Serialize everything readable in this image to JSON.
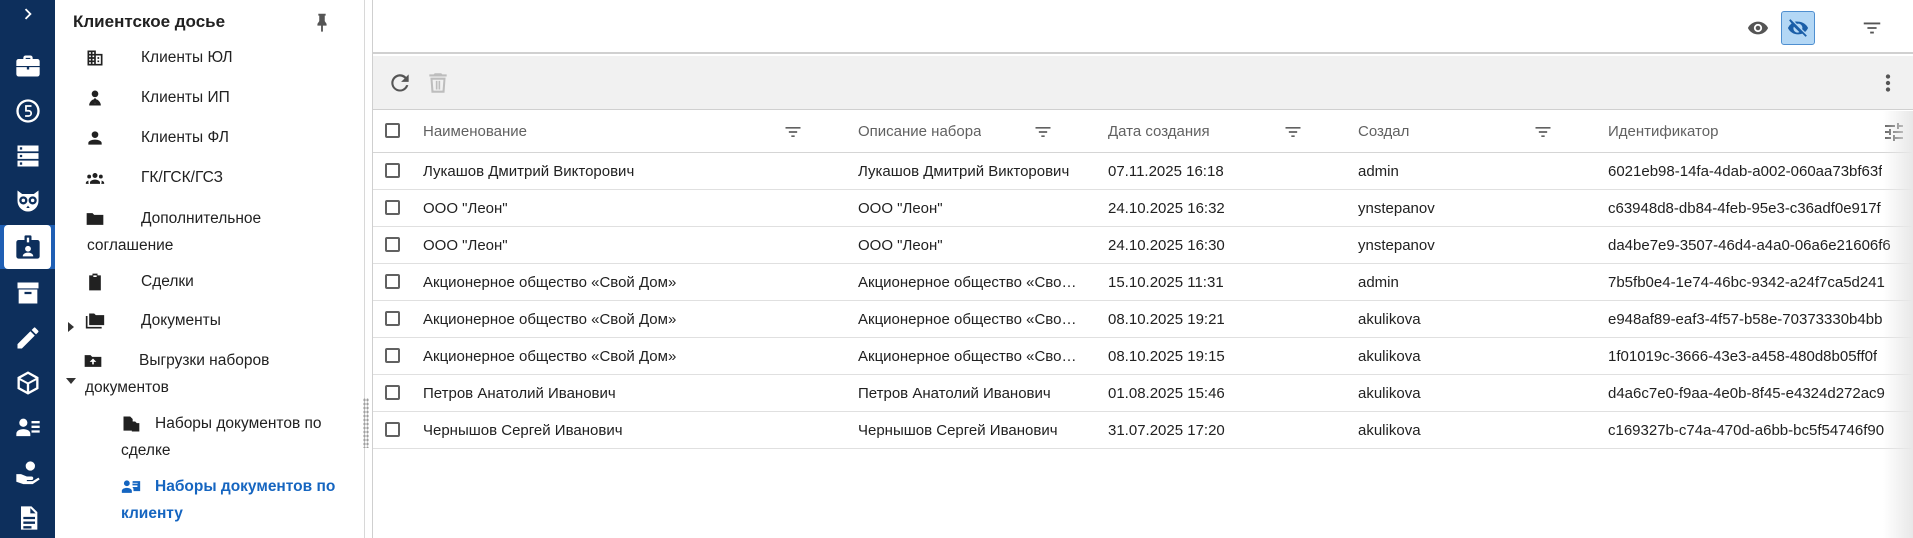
{
  "tree": {
    "title": "Клиентское досье",
    "items": [
      {
        "label": "Клиенты ЮЛ"
      },
      {
        "label": "Клиенты ИП"
      },
      {
        "label": "Клиенты ФЛ"
      },
      {
        "label": "ГК/ГСК/ГСЗ"
      },
      {
        "label_line1": "Дополнительное",
        "label_line2": "соглашение"
      },
      {
        "label": "Сделки"
      },
      {
        "label": "Документы"
      },
      {
        "label_line1": "Выгрузки наборов",
        "label_line2": "документов"
      },
      {
        "label_line1": "Наборы документов по",
        "label_line2": "сделке"
      },
      {
        "label_line1": "Наборы документов по",
        "label_line2": "клиенту"
      }
    ]
  },
  "grid": {
    "columns": [
      "Наименование",
      "Описание набора",
      "Дата создания",
      "Создал",
      "Идентификатор"
    ],
    "rows": [
      [
        "Лукашов Дмитрий Викторович",
        "Лукашов Дмитрий Викторович",
        "07.11.2025 16:18",
        "admin",
        "6021eb98-14fa-4dab-a002-060aa73bf63f"
      ],
      [
        "ООО \"Леон\"",
        "ООО \"Леон\"",
        "24.10.2025 16:32",
        "ynstepanov",
        "c63948d8-db84-4feb-95e3-c36adf0e917f"
      ],
      [
        "ООО \"Леон\"",
        "ООО \"Леон\"",
        "24.10.2025 16:30",
        "ynstepanov",
        "da4be7e9-3507-46d4-a4a0-06a6e21606f6"
      ],
      [
        "Акционерное общество «Свой Дом»",
        "Акционерное общество «Свой Дом»",
        "15.10.2025 11:31",
        "admin",
        "7b5fb0e4-1e74-46bc-9342-a24f7ca5d241"
      ],
      [
        "Акционерное общество «Свой Дом»",
        "Акционерное общество «Свой Дом»",
        "08.10.2025 19:21",
        "akulikova",
        "e948af89-eaf3-4f57-b58e-70373330b4bb"
      ],
      [
        "Акционерное общество «Свой Дом»",
        "Акционерное общество «Свой Дом»",
        "08.10.2025 19:15",
        "akulikova",
        "1f01019c-3666-43e3-a458-480d8b05ff0f"
      ],
      [
        "Петров Анатолий Иванович",
        "Петров Анатолий Иванович",
        "01.08.2025 15:46",
        "akulikova",
        "d4a6c7e0-f9aa-4e0b-8f45-e4324d272ac9"
      ],
      [
        "Чернышов Сергей Иванович",
        "Чернышов Сергей Иванович",
        "31.07.2025 17:20",
        "akulikova",
        "c169327b-c74a-470d-a6bb-bc5f54746f90"
      ]
    ]
  },
  "icons": {
    "rail": [
      "chevron-right-icon",
      "briefcase-icon",
      "five-circle-icon",
      "server-icon",
      "owl-icon",
      "client-badge-icon",
      "archive-icon",
      "pencil-icon",
      "cube-icon",
      "id-card-icon",
      "hand-coin-icon",
      "document-icon"
    ]
  },
  "colors": {
    "rail_bg": "#0d2f5c",
    "accent": "#1565c0",
    "toggle_active_bg": "#b3d7f5"
  }
}
